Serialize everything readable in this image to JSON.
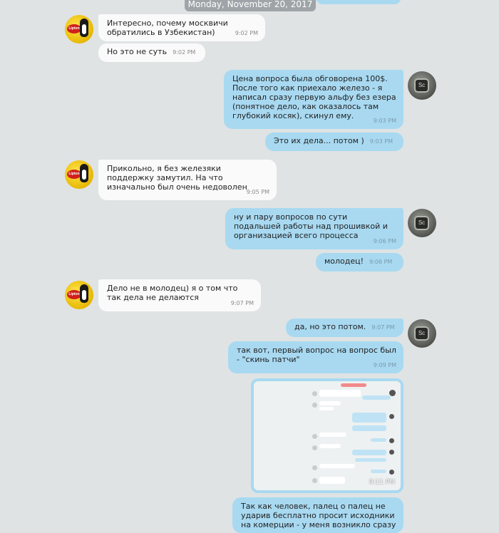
{
  "date_separator": "Monday, November 20, 2017",
  "messages": [
    {
      "text": "Интересно, почему москвичи обратились в Узбекистан)",
      "time": "9:02 PM"
    },
    {
      "text": "Но это не суть",
      "time": "9:02 PM"
    },
    {
      "text": "Цена вопроса была обговорена 100$. После того как приехало железо - я написал сразу первую альфу без езера (понятное дело, как оказалось там глубокий косяк), скинул ему.",
      "time": "9:03 PM"
    },
    {
      "text": "Это их дела... потом )",
      "time": "9:03 PM"
    },
    {
      "text": "Прикольно, я без железяки поддержку замутил. На что изначально был очень недоволен",
      "time": "9:05 PM"
    },
    {
      "text": "ну и пару вопросов по сути подальшей работы над прошивкой и организацией всего процесса",
      "time": "9:06 PM"
    },
    {
      "text": "молодец!",
      "time": "9:06 PM"
    },
    {
      "text": "Дело не в молодец) я о том что так дела не делаются",
      "time": "9:07 PM"
    },
    {
      "text": "да, но это потом.",
      "time": "9:07 PM"
    },
    {
      "text": "так вот, первый вопрос на вопрос был - \"скинь патчи\"",
      "time": "9:09 PM"
    },
    {
      "text": "",
      "time": "9:11 PM"
    },
    {
      "text": "Так как человек, палец о палец не ударив бесплатно просит исходники на комерции - у меня возникло сразу",
      "time": ""
    }
  ],
  "avatar_icons": {
    "incoming": "lipton-avatar",
    "outgoing": "metal-tag-avatar"
  },
  "avatar_text": {
    "incoming": "Lipton",
    "outgoing": "Sc"
  },
  "colors": {
    "background": "#dfe3e4",
    "incoming_bubble": "#fafafa",
    "outgoing_bubble": "#a8d9f1",
    "date_badge": "#9ea4a7"
  }
}
